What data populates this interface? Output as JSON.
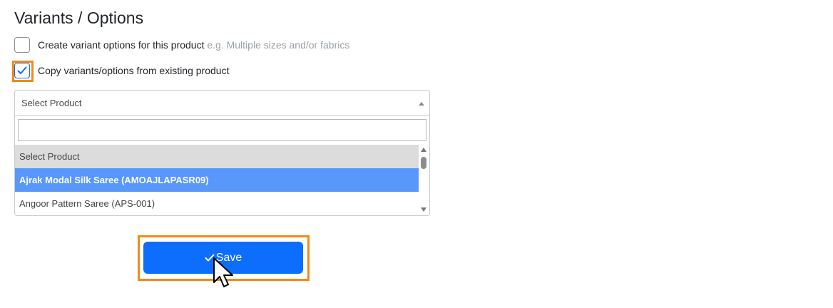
{
  "section": {
    "title": "Variants / Options"
  },
  "options": {
    "create_label": "Create variant options for this product",
    "create_hint": "e.g. Multiple sizes and/or fabrics",
    "copy_label": "Copy variants/options from existing product"
  },
  "select": {
    "current": "Select Product",
    "search_value": "",
    "items": [
      "Select Product",
      "Ajrak Modal Silk Saree (AMOAJLAPASR09)",
      "Angoor Pattern Saree (APS-001)"
    ]
  },
  "actions": {
    "save_label": "Save"
  },
  "icons": {
    "checkbox_check": "check-icon",
    "save": "check-icon",
    "cursor": "pointer-cursor-icon"
  },
  "colors": {
    "primary": "#0d6efd",
    "highlight": "#5897fb",
    "focus_outline": "#f28a17"
  }
}
